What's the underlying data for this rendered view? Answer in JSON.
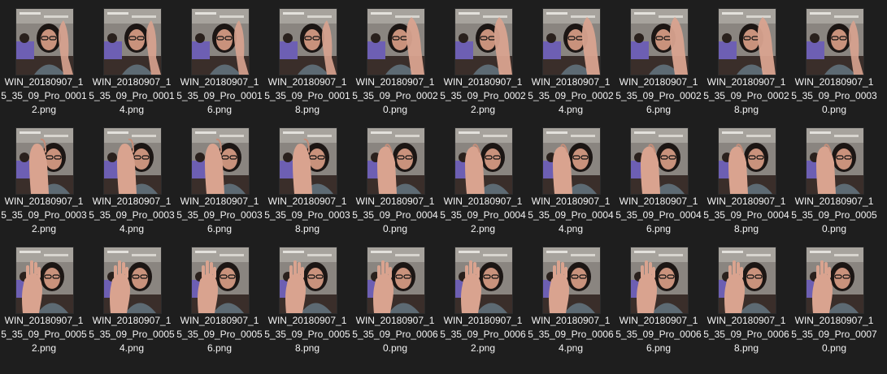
{
  "files": [
    {
      "name_line1": "WIN_20180907_1",
      "name_line2": "5_35_09_Pro_0001",
      "name_line3": "2.png",
      "hand": 0
    },
    {
      "name_line1": "WIN_20180907_1",
      "name_line2": "5_35_09_Pro_0001",
      "name_line3": "4.png",
      "hand": 0
    },
    {
      "name_line1": "WIN_20180907_1",
      "name_line2": "5_35_09_Pro_0001",
      "name_line3": "6.png",
      "hand": 0
    },
    {
      "name_line1": "WIN_20180907_1",
      "name_line2": "5_35_09_Pro_0001",
      "name_line3": "8.png",
      "hand": 0
    },
    {
      "name_line1": "WIN_20180907_1",
      "name_line2": "5_35_09_Pro_0002",
      "name_line3": "0.png",
      "hand": 1
    },
    {
      "name_line1": "WIN_20180907_1",
      "name_line2": "5_35_09_Pro_0002",
      "name_line3": "2.png",
      "hand": 1
    },
    {
      "name_line1": "WIN_20180907_1",
      "name_line2": "5_35_09_Pro_0002",
      "name_line3": "4.png",
      "hand": 1
    },
    {
      "name_line1": "WIN_20180907_1",
      "name_line2": "5_35_09_Pro_0002",
      "name_line3": "6.png",
      "hand": 1
    },
    {
      "name_line1": "WIN_20180907_1",
      "name_line2": "5_35_09_Pro_0002",
      "name_line3": "8.png",
      "hand": 1
    },
    {
      "name_line1": "WIN_20180907_1",
      "name_line2": "5_35_09_Pro_0003",
      "name_line3": "0.png",
      "hand": 0
    },
    {
      "name_line1": "WIN_20180907_1",
      "name_line2": "5_35_09_Pro_0003",
      "name_line3": "2.png",
      "hand": 2
    },
    {
      "name_line1": "WIN_20180907_1",
      "name_line2": "5_35_09_Pro_0003",
      "name_line3": "4.png",
      "hand": 2
    },
    {
      "name_line1": "WIN_20180907_1",
      "name_line2": "5_35_09_Pro_0003",
      "name_line3": "6.png",
      "hand": 2
    },
    {
      "name_line1": "WIN_20180907_1",
      "name_line2": "5_35_09_Pro_0003",
      "name_line3": "8.png",
      "hand": 2
    },
    {
      "name_line1": "WIN_20180907_1",
      "name_line2": "5_35_09_Pro_0004",
      "name_line3": "0.png",
      "hand": 3
    },
    {
      "name_line1": "WIN_20180907_1",
      "name_line2": "5_35_09_Pro_0004",
      "name_line3": "2.png",
      "hand": 3
    },
    {
      "name_line1": "WIN_20180907_1",
      "name_line2": "5_35_09_Pro_0004",
      "name_line3": "4.png",
      "hand": 3
    },
    {
      "name_line1": "WIN_20180907_1",
      "name_line2": "5_35_09_Pro_0004",
      "name_line3": "6.png",
      "hand": 3
    },
    {
      "name_line1": "WIN_20180907_1",
      "name_line2": "5_35_09_Pro_0004",
      "name_line3": "8.png",
      "hand": 3
    },
    {
      "name_line1": "WIN_20180907_1",
      "name_line2": "5_35_09_Pro_0005",
      "name_line3": "0.png",
      "hand": 3
    },
    {
      "name_line1": "WIN_20180907_1",
      "name_line2": "5_35_09_Pro_0005",
      "name_line3": "2.png",
      "hand": 4
    },
    {
      "name_line1": "WIN_20180907_1",
      "name_line2": "5_35_09_Pro_0005",
      "name_line3": "4.png",
      "hand": 4
    },
    {
      "name_line1": "WIN_20180907_1",
      "name_line2": "5_35_09_Pro_0005",
      "name_line3": "6.png",
      "hand": 4
    },
    {
      "name_line1": "WIN_20180907_1",
      "name_line2": "5_35_09_Pro_0005",
      "name_line3": "8.png",
      "hand": 4
    },
    {
      "name_line1": "WIN_20180907_1",
      "name_line2": "5_35_09_Pro_0006",
      "name_line3": "0.png",
      "hand": 4
    },
    {
      "name_line1": "WIN_20180907_1",
      "name_line2": "5_35_09_Pro_0006",
      "name_line3": "2.png",
      "hand": 4
    },
    {
      "name_line1": "WIN_20180907_1",
      "name_line2": "5_35_09_Pro_0006",
      "name_line3": "4.png",
      "hand": 4
    },
    {
      "name_line1": "WIN_20180907_1",
      "name_line2": "5_35_09_Pro_0006",
      "name_line3": "6.png",
      "hand": 4
    },
    {
      "name_line1": "WIN_20180907_1",
      "name_line2": "5_35_09_Pro_0006",
      "name_line3": "8.png",
      "hand": 4
    },
    {
      "name_line1": "WIN_20180907_1",
      "name_line2": "5_35_09_Pro_0007",
      "name_line3": "0.png",
      "hand": 4
    }
  ],
  "colors": {
    "background": "#1e1e1e",
    "label": "#f2f2f2",
    "skin": "#d9a38f",
    "hair": "#1c1614",
    "shirt": "#6d5fb3",
    "wall": "#8a8580"
  }
}
